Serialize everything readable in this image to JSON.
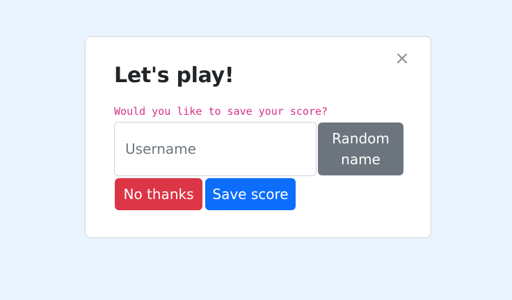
{
  "modal": {
    "title": "Let's play!",
    "close_symbol": "×",
    "close_icon": "close-icon",
    "prompt": "Would you like to save your score?",
    "username_placeholder": "Username",
    "username_value": "",
    "random_name_label": "Random name",
    "no_thanks_label": "No thanks",
    "save_score_label": "Save score"
  },
  "colors": {
    "page_background": "#eaf4fe",
    "prompt_text": "#d63384",
    "secondary_button": "#6c757d",
    "danger_button": "#dc3545",
    "primary_button": "#0d6efd"
  }
}
